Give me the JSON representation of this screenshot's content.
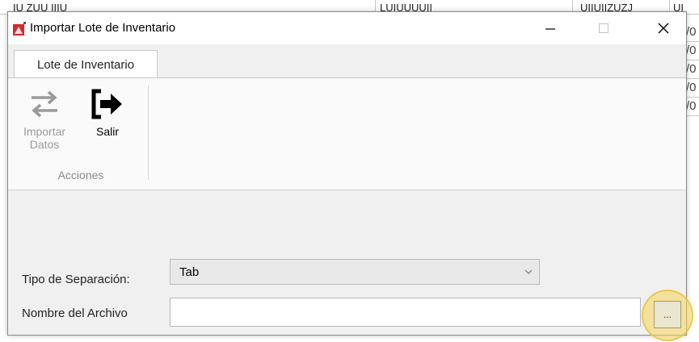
{
  "window": {
    "title": "Importar Lote de Inventario"
  },
  "ribbon": {
    "tab_label": "Lote de Inventario",
    "import_label_line1": "Importar",
    "import_label_line2": "Datos",
    "exit_label": "Salir",
    "group_label": "Acciones"
  },
  "form": {
    "separator_label": "Tipo de Separación:",
    "separator_value": "Tab",
    "file_label": "Nombre del Archivo",
    "file_value": "",
    "browse_label": "..."
  },
  "background": {
    "top_row": [
      "IU ZUU IIIU",
      "LUIUUUUII",
      "UIIUIIZUZJ",
      "UI"
    ],
    "side_fragments": [
      "/0",
      "/0",
      "/0",
      "/0",
      "/0"
    ]
  },
  "colors": {
    "window_bg": "#f0f0f0",
    "disabled_text": "#9a9a9a",
    "highlight": "#f7d65a"
  }
}
